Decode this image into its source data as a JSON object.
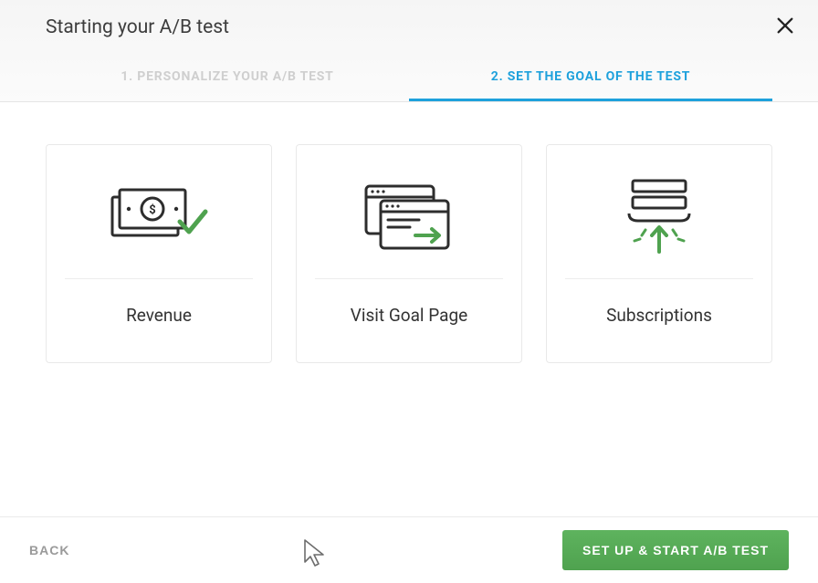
{
  "header": {
    "title": "Starting your A/B test"
  },
  "tabs": [
    {
      "label": "1. PERSONALIZE YOUR A/B TEST",
      "active": false
    },
    {
      "label": "2. SET THE GOAL OF THE TEST",
      "active": true
    }
  ],
  "cards": [
    {
      "title": "Revenue",
      "icon": "revenue-icon"
    },
    {
      "title": "Visit Goal Page",
      "icon": "goal-page-icon"
    },
    {
      "title": "Subscriptions",
      "icon": "subscriptions-icon"
    }
  ],
  "footer": {
    "back_label": "BACK",
    "primary_label": "SET UP & START A/B TEST"
  }
}
